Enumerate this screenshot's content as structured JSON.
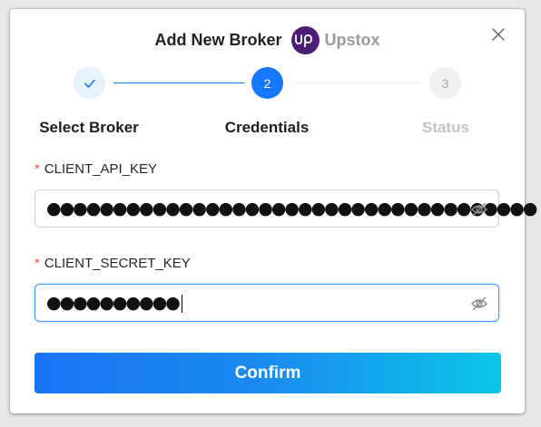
{
  "dialog": {
    "title": "Add New Broker",
    "broker_name": "Upstox",
    "broker_logo_text": "up",
    "close_icon": "close-icon"
  },
  "steps": [
    {
      "number": "1",
      "label": "Select Broker",
      "status": "done",
      "icon": "check-icon"
    },
    {
      "number": "2",
      "label": "Credentials",
      "status": "active"
    },
    {
      "number": "3",
      "label": "Status",
      "status": "pending"
    }
  ],
  "fields": {
    "api_key": {
      "required_mark": "*",
      "label": "CLIENT_API_KEY",
      "masked_value": "●●●●●●●●●●●●●●●●●●●●●●●●●●●●●●●●●●●●●",
      "visibility_icon": "eye-off-icon"
    },
    "secret_key": {
      "required_mark": "*",
      "label": "CLIENT_SECRET_KEY",
      "masked_value": "●●●●●●●●●●",
      "visibility_icon": "eye-off-icon",
      "focused": true
    }
  },
  "actions": {
    "confirm_label": "Confirm"
  },
  "colors": {
    "primary": "#1677ff",
    "broker_logo_bg": "#4a1f73",
    "required": "#ff4d4f",
    "button_gradient_start": "#1a73f2",
    "button_gradient_end": "#0bc5e6"
  }
}
